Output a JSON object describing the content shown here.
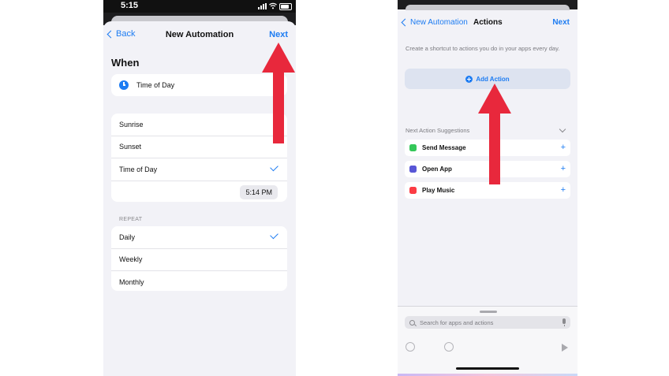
{
  "left": {
    "status_time": "5:15",
    "nav": {
      "back": "Back",
      "title": "New Automation",
      "next": "Next"
    },
    "section_title": "When",
    "trigger": {
      "label": "Time of Day"
    },
    "options": [
      {
        "label": "Sunrise",
        "checked": false
      },
      {
        "label": "Sunset",
        "checked": false
      },
      {
        "label": "Time of Day",
        "checked": true
      }
    ],
    "time_value": "5:14 PM",
    "repeat_label": "REPEAT",
    "repeat_options": [
      {
        "label": "Daily",
        "checked": true
      },
      {
        "label": "Weekly",
        "checked": false
      },
      {
        "label": "Monthly",
        "checked": false
      }
    ]
  },
  "right": {
    "nav": {
      "back": "New Automation",
      "title": "Actions",
      "next": "Next"
    },
    "hint": "Create a shortcut to actions you do in your apps every day.",
    "add_action": "Add Action",
    "suggestions_label": "Next Action Suggestions",
    "suggestions": [
      {
        "label": "Send Message",
        "icon": "messages-icon",
        "color": "#34c759"
      },
      {
        "label": "Open App",
        "icon": "open-app-icon",
        "color": "#5856d6"
      },
      {
        "label": "Play Music",
        "icon": "music-icon",
        "color": "#fc3c44"
      }
    ],
    "search_placeholder": "Search for apps and actions"
  },
  "colors": {
    "accent": "#1d7cf2",
    "arrow": "#e8283c"
  }
}
